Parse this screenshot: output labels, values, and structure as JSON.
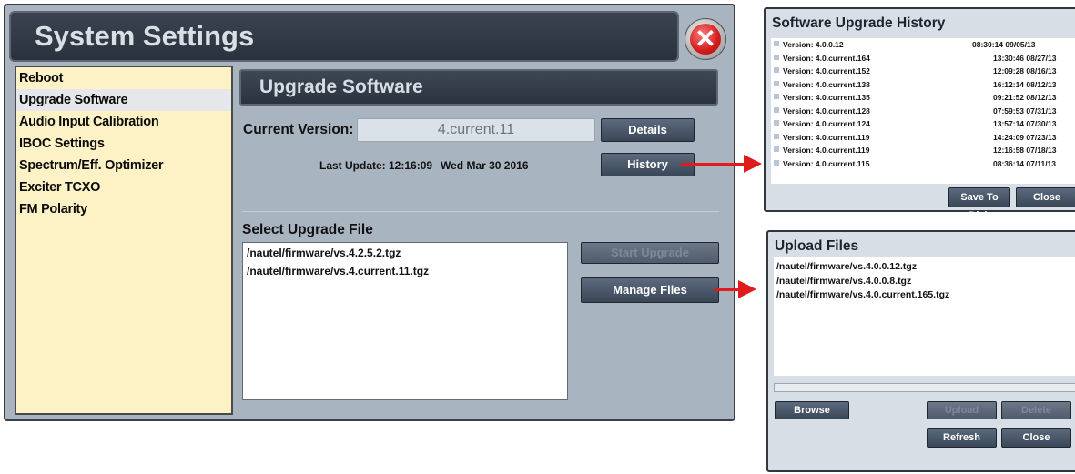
{
  "window": {
    "title": "System Settings",
    "close_icon": "x-icon"
  },
  "sidebar": {
    "items": [
      {
        "label": "Reboot",
        "selected": false
      },
      {
        "label": "Upgrade Software",
        "selected": true
      },
      {
        "label": "Audio Input Calibration",
        "selected": false
      },
      {
        "label": "IBOC Settings",
        "selected": false
      },
      {
        "label": "Spectrum/Eff. Optimizer",
        "selected": false
      },
      {
        "label": "Exciter TCXO",
        "selected": false
      },
      {
        "label": "FM Polarity",
        "selected": false
      }
    ]
  },
  "main": {
    "heading": "Upgrade Software",
    "current_version_label": "Current Version:",
    "current_version_value": "4.current.11",
    "details_button": "Details",
    "last_update_label": "Last Update: 12:16:09",
    "last_update_date": "Wed Mar 30 2016",
    "history_button": "History",
    "select_file_label": "Select Upgrade File",
    "files": [
      "/nautel/firmware/vs.4.2.5.2.tgz",
      "/nautel/firmware/vs.4.current.11.tgz"
    ],
    "start_upgrade_button": "Start Upgrade",
    "manage_files_button": "Manage Files"
  },
  "history_panel": {
    "title": "Software Upgrade History",
    "rows": [
      {
        "version": "Version: 4.0.0.12",
        "datetime": "08:30:14 09/05/13",
        "col": "a"
      },
      {
        "version": "Version: 4.0.current.164",
        "datetime": "13:30:46 08/27/13",
        "col": "b"
      },
      {
        "version": "Version: 4.0.current.152",
        "datetime": "12:09:28 08/16/13",
        "col": "b"
      },
      {
        "version": "Version: 4.0.current.138",
        "datetime": "16:12:14 08/12/13",
        "col": "b"
      },
      {
        "version": "Version: 4.0.current.135",
        "datetime": "09:21:52 08/12/13",
        "col": "b"
      },
      {
        "version": "Version: 4.0.current.128",
        "datetime": "07:59:53 07/31/13",
        "col": "b"
      },
      {
        "version": "Version: 4.0.current.124",
        "datetime": "13:57:14 07/30/13",
        "col": "b"
      },
      {
        "version": "Version: 4.0.current.119",
        "datetime": "14:24:09 07/23/13",
        "col": "b"
      },
      {
        "version": "Version: 4.0.current.119",
        "datetime": "12:16:58 07/18/13",
        "col": "b"
      },
      {
        "version": "Version: 4.0.current.115",
        "datetime": "08:36:14 07/11/13",
        "col": "b"
      }
    ],
    "save_button": "Save To Disk",
    "close_button": "Close"
  },
  "upload_panel": {
    "title": "Upload Files",
    "files": [
      "/nautel/firmware/vs.4.0.0.12.tgz",
      "/nautel/firmware/vs.4.0.0.8.tgz",
      "/nautel/firmware/vs.4.0.current.165.tgz"
    ],
    "browse_button": "Browse",
    "upload_button": "Upload",
    "delete_button": "Delete",
    "refresh_button": "Refresh",
    "close_button": "Close"
  },
  "colors": {
    "window_bg": "#a9b4c1",
    "sidebar_bg": "#fdf2c5",
    "arrow": "#e01b1b"
  }
}
